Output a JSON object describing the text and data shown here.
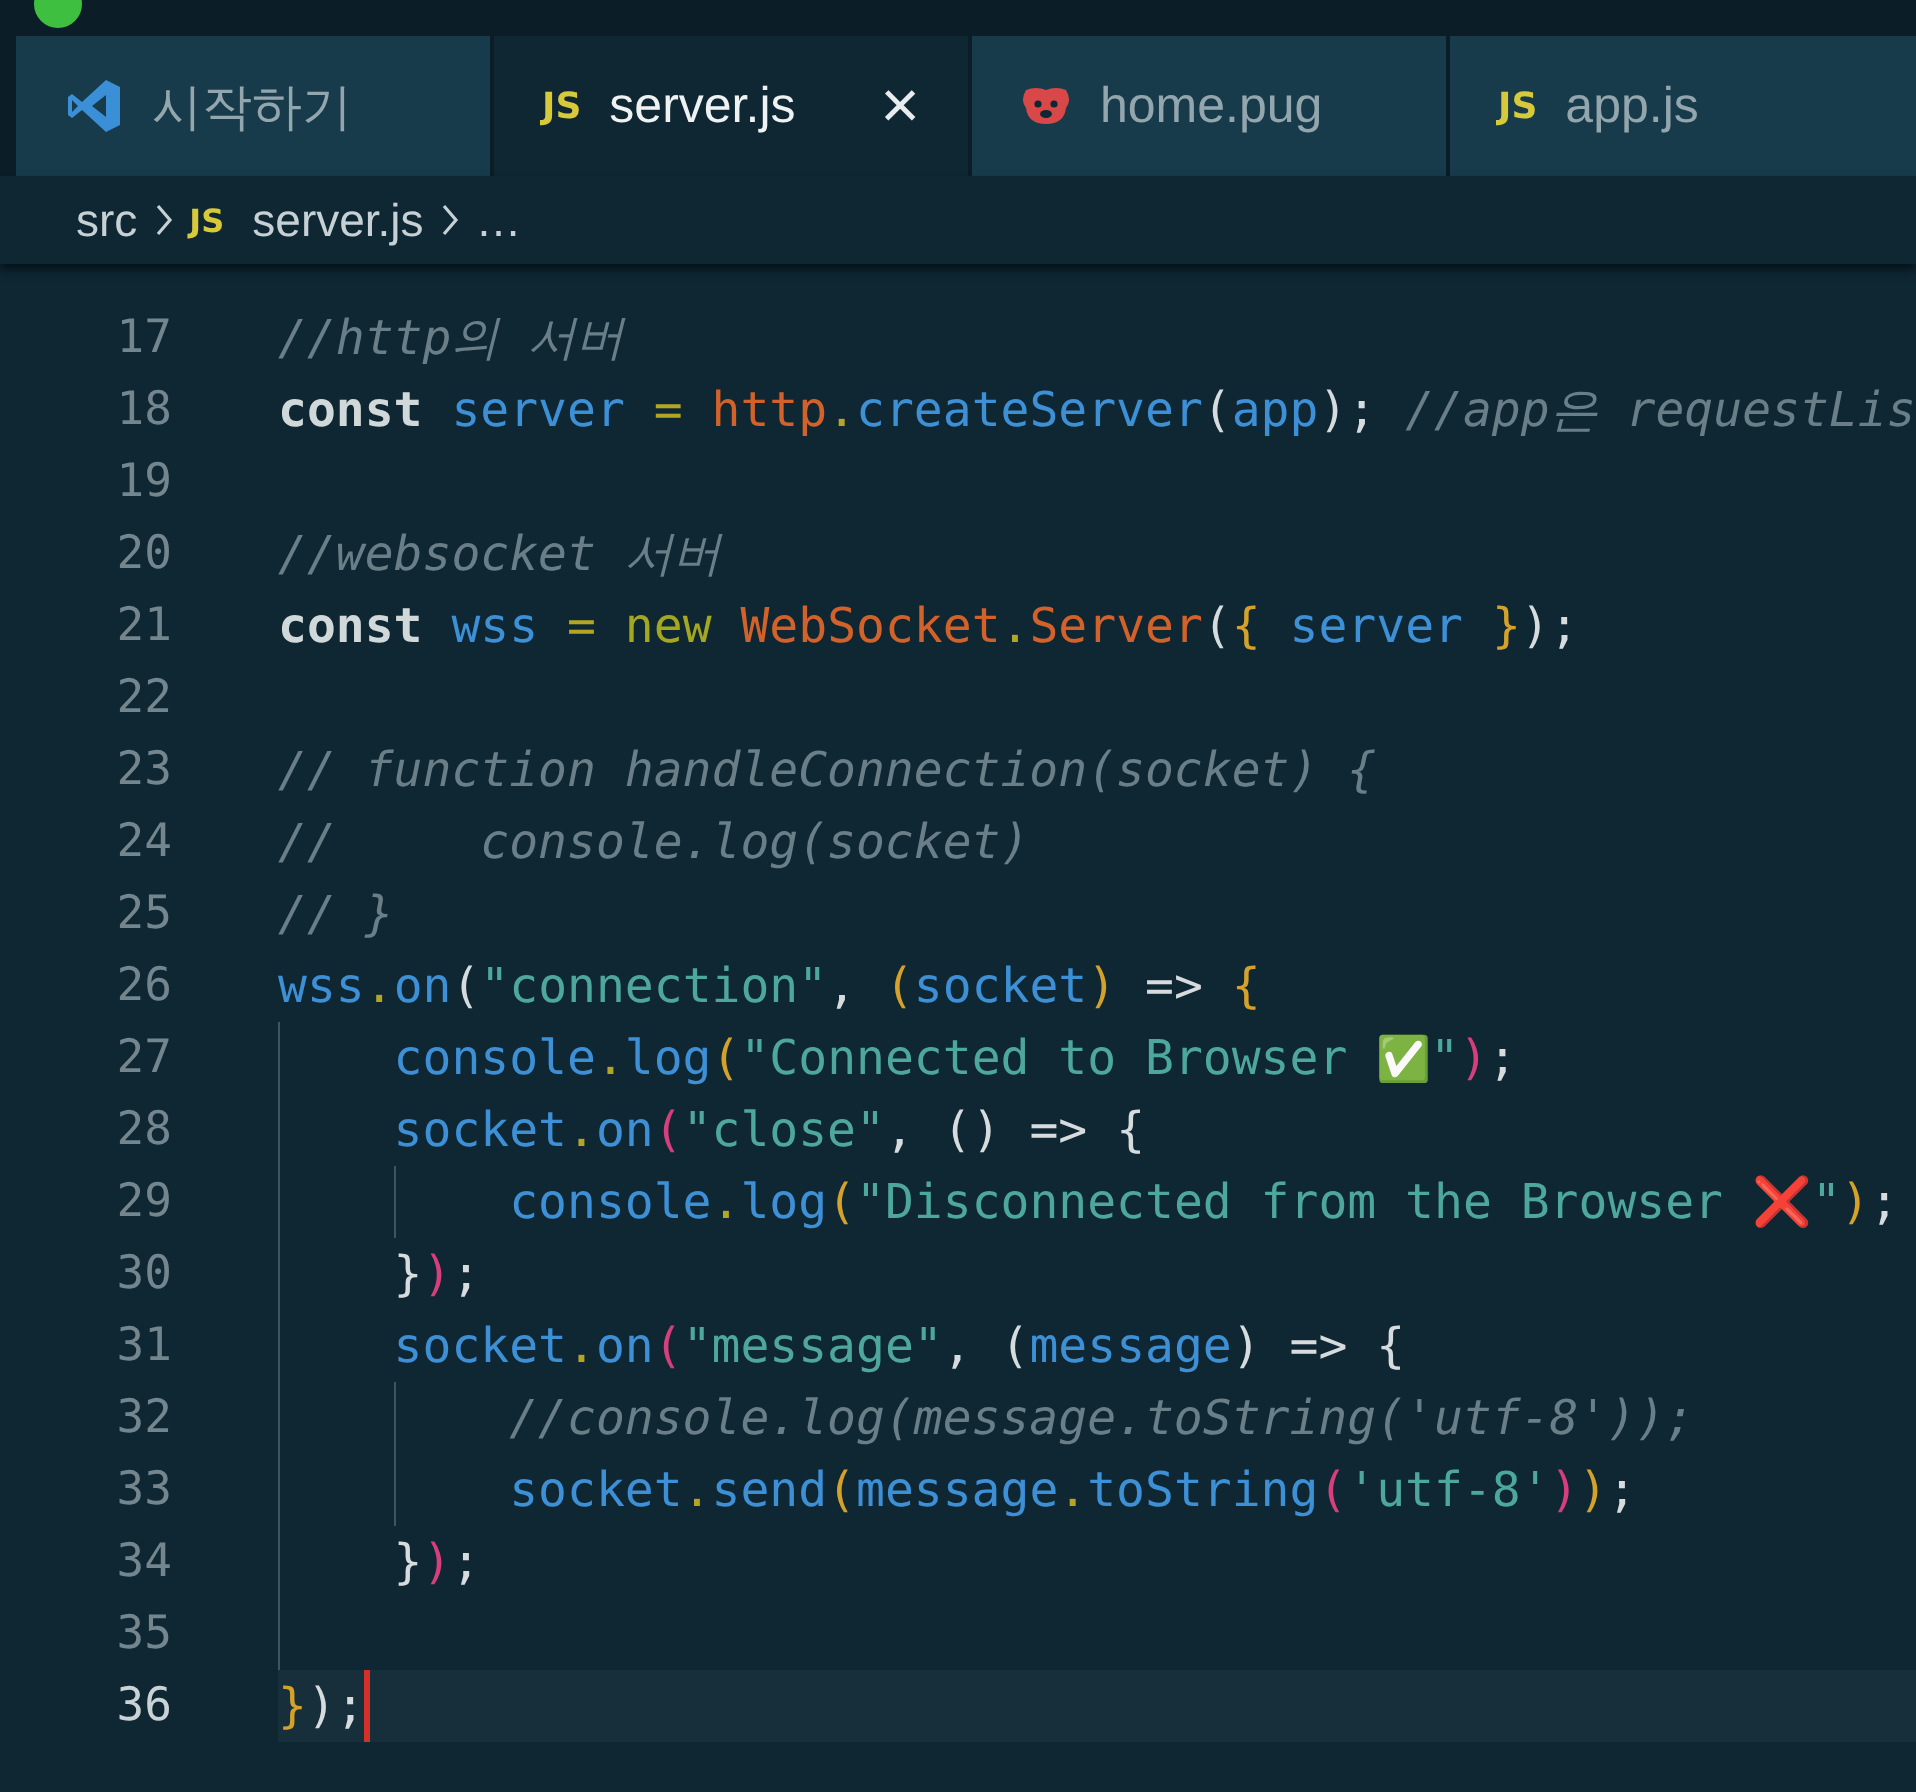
{
  "tabs": [
    {
      "kind": "welcome",
      "label": "시작하기",
      "selected": false
    },
    {
      "kind": "js",
      "icon_text": "JS",
      "label": "server.js",
      "selected": true,
      "close": "×"
    },
    {
      "kind": "pug",
      "label": "home.pug",
      "selected": false
    },
    {
      "kind": "js",
      "icon_text": "JS",
      "label": "app.js",
      "selected": false
    }
  ],
  "breadcrumb": [
    {
      "label": "src"
    },
    {
      "icon_text": "JS",
      "label": "server.js"
    },
    {
      "label": "…"
    }
  ],
  "editor": {
    "lines": [
      {
        "number": "17",
        "current": false,
        "tokens": [
          {
            "kind": "comment",
            "text": "//http의 서버"
          }
        ]
      },
      {
        "number": "18",
        "current": false,
        "tokens": [
          {
            "kind": "keyword",
            "text": "const "
          },
          {
            "kind": "ident",
            "text": "server"
          },
          {
            "kind": "dot",
            "text": " = "
          },
          {
            "kind": "builtin",
            "text": "http"
          },
          {
            "kind": "dot",
            "text": "."
          },
          {
            "kind": "ident",
            "text": "createServer"
          },
          {
            "kind": "punct",
            "text": "("
          },
          {
            "kind": "ident",
            "text": "app"
          },
          {
            "kind": "punct",
            "text": "); "
          },
          {
            "kind": "comment",
            "text": "//app은 requestLis"
          }
        ]
      },
      {
        "number": "19",
        "current": false
      },
      {
        "number": "20",
        "current": false,
        "tokens": [
          {
            "kind": "comment",
            "text": "//websocket 서버"
          }
        ]
      },
      {
        "number": "21",
        "current": false,
        "tokens": [
          {
            "kind": "keyword",
            "text": "const "
          },
          {
            "kind": "ident",
            "text": "wss"
          },
          {
            "kind": "dot",
            "text": " = "
          },
          {
            "kind": "new",
            "text": "new "
          },
          {
            "kind": "builtin",
            "text": "WebSocket"
          },
          {
            "kind": "dot",
            "text": "."
          },
          {
            "kind": "builtin",
            "text": "Server"
          },
          {
            "kind": "punct",
            "text": "("
          },
          {
            "kind": "bracket1",
            "text": "{ "
          },
          {
            "kind": "ident",
            "text": "server "
          },
          {
            "kind": "bracket1",
            "text": "}"
          },
          {
            "kind": "punct",
            "text": ");"
          }
        ]
      },
      {
        "number": "22",
        "current": false
      },
      {
        "number": "23",
        "current": false,
        "tokens": [
          {
            "kind": "comment",
            "text": "// function handleConnection(socket) {"
          }
        ]
      },
      {
        "number": "24",
        "current": false,
        "tokens": [
          {
            "kind": "comment",
            "text": "//     console.log(socket)"
          }
        ]
      },
      {
        "number": "25",
        "current": false,
        "tokens": [
          {
            "kind": "comment",
            "text": "// }"
          }
        ]
      },
      {
        "number": "26",
        "current": false,
        "tokens": [
          {
            "kind": "ident",
            "text": "wss"
          },
          {
            "kind": "dot",
            "text": "."
          },
          {
            "kind": "ident",
            "text": "on"
          },
          {
            "kind": "punct",
            "text": "("
          },
          {
            "kind": "string",
            "text": "\"connection\""
          },
          {
            "kind": "punct",
            "text": ", "
          },
          {
            "kind": "bracket1",
            "text": "("
          },
          {
            "kind": "ident",
            "text": "socket"
          },
          {
            "kind": "bracket1",
            "text": ")"
          },
          {
            "kind": "punct",
            "text": " => "
          },
          {
            "kind": "bracket1",
            "text": "{"
          }
        ]
      },
      {
        "number": "27",
        "current": false,
        "tokens": [
          {
            "kind": "ident",
            "text": "    console"
          },
          {
            "kind": "dot",
            "text": "."
          },
          {
            "kind": "ident",
            "text": "log"
          },
          {
            "kind": "bracket1",
            "text": "("
          },
          {
            "kind": "string",
            "text": "\"Connected to Browser "
          },
          {
            "kind": "check-emoji",
            "text": "✅"
          },
          {
            "kind": "string",
            "text": "\""
          },
          {
            "kind": "bracket2",
            "text": ")"
          },
          {
            "kind": "punct",
            "text": ";"
          }
        ]
      },
      {
        "number": "28",
        "current": false,
        "tokens": [
          {
            "kind": "ident",
            "text": "    socket"
          },
          {
            "kind": "dot",
            "text": "."
          },
          {
            "kind": "ident",
            "text": "on"
          },
          {
            "kind": "bracket2",
            "text": "("
          },
          {
            "kind": "string",
            "text": "\"close\""
          },
          {
            "kind": "punct",
            "text": ", () => {"
          }
        ]
      },
      {
        "number": "29",
        "current": false,
        "tokens": [
          {
            "kind": "ident",
            "text": "        console"
          },
          {
            "kind": "dot",
            "text": "."
          },
          {
            "kind": "ident",
            "text": "log"
          },
          {
            "kind": "bracket1",
            "text": "("
          },
          {
            "kind": "string",
            "text": "\"Disconnected from the Browser "
          },
          {
            "kind": "cross-emoji",
            "text": "❌"
          },
          {
            "kind": "string",
            "text": "\""
          },
          {
            "kind": "bracket1",
            "text": ")"
          },
          {
            "kind": "punct",
            "text": ";"
          }
        ]
      },
      {
        "number": "30",
        "current": false,
        "tokens": [
          {
            "kind": "punct",
            "text": "    }"
          },
          {
            "kind": "bracket2",
            "text": ")"
          },
          {
            "kind": "punct",
            "text": ";"
          }
        ]
      },
      {
        "number": "31",
        "current": false,
        "tokens": [
          {
            "kind": "ident",
            "text": "    socket"
          },
          {
            "kind": "dot",
            "text": "."
          },
          {
            "kind": "ident",
            "text": "on"
          },
          {
            "kind": "bracket2",
            "text": "("
          },
          {
            "kind": "string",
            "text": "\"message\""
          },
          {
            "kind": "punct",
            "text": ", ("
          },
          {
            "kind": "ident",
            "text": "message"
          },
          {
            "kind": "punct",
            "text": ") => {"
          }
        ]
      },
      {
        "number": "32",
        "current": false,
        "tokens": [
          {
            "kind": "comment",
            "text": "        //console.log(message.toString('utf-8'));"
          }
        ]
      },
      {
        "number": "33",
        "current": false,
        "tokens": [
          {
            "kind": "ident",
            "text": "        socket"
          },
          {
            "kind": "dot",
            "text": "."
          },
          {
            "kind": "ident",
            "text": "send"
          },
          {
            "kind": "bracket1",
            "text": "("
          },
          {
            "kind": "ident",
            "text": "message"
          },
          {
            "kind": "dot",
            "text": "."
          },
          {
            "kind": "ident",
            "text": "toString"
          },
          {
            "kind": "bracket2",
            "text": "("
          },
          {
            "kind": "string",
            "text": "'utf-8'"
          },
          {
            "kind": "bracket2",
            "text": ")"
          },
          {
            "kind": "bracket1",
            "text": ")"
          },
          {
            "kind": "punct",
            "text": ";"
          }
        ]
      },
      {
        "number": "34",
        "current": false,
        "tokens": [
          {
            "kind": "punct",
            "text": "    }"
          },
          {
            "kind": "bracket2",
            "text": ")"
          },
          {
            "kind": "punct",
            "text": ";"
          }
        ]
      },
      {
        "number": "35",
        "current": false
      },
      {
        "number": "36",
        "current": true,
        "tokens": [
          {
            "kind": "bracket1",
            "text": "}"
          },
          {
            "kind": "punct",
            "text": ");"
          }
        ]
      }
    ]
  }
}
